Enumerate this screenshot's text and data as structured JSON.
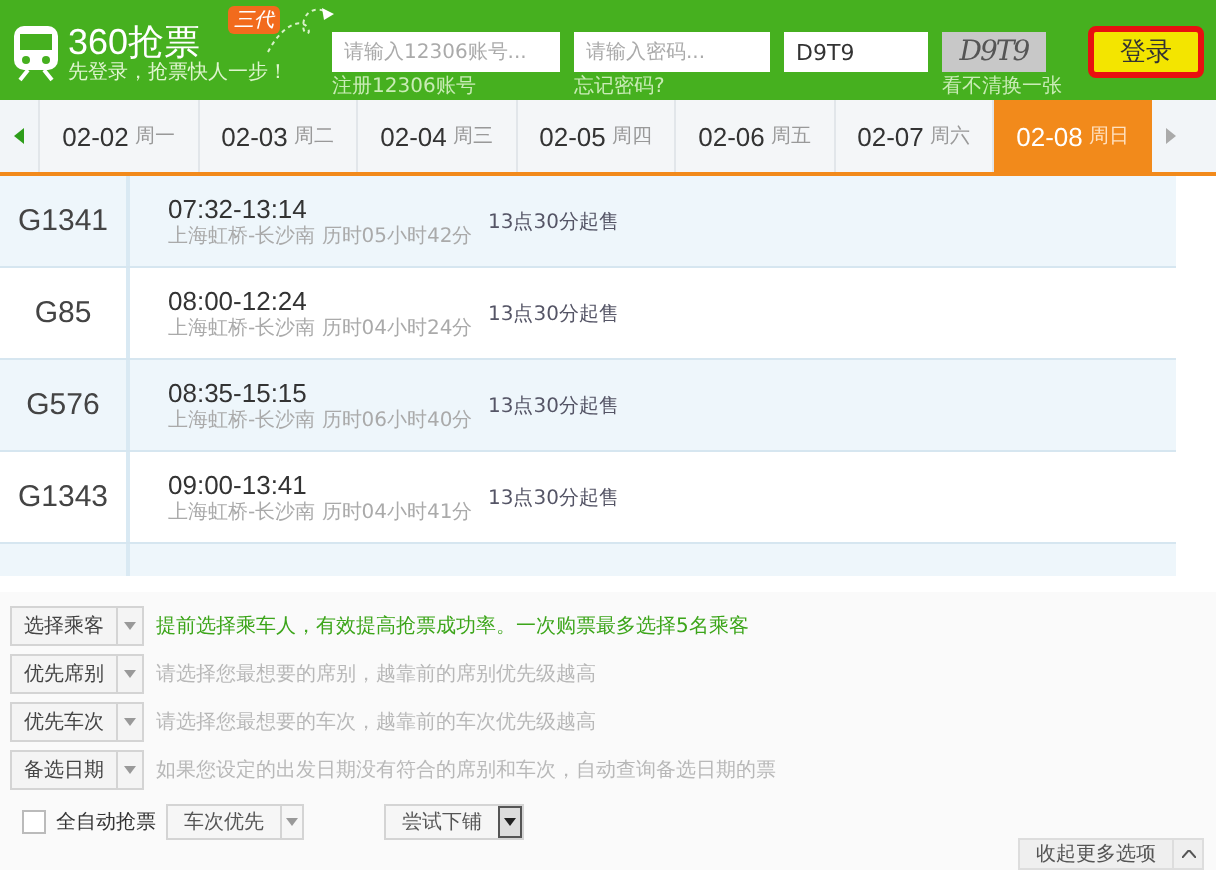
{
  "header": {
    "logo_text": "360抢票",
    "badge": "三代",
    "slogan": "先登录，抢票快人一步！",
    "account": {
      "placeholder": "请输入12306账号...",
      "link": "注册12306账号"
    },
    "password": {
      "placeholder": "请输入密码...",
      "link": "忘记密码?"
    },
    "captcha_input": {
      "value": "D9T9"
    },
    "captcha": {
      "text": "D9T9",
      "link": "看不清换一张"
    },
    "login_button": "登录"
  },
  "dates": [
    {
      "date": "02-02",
      "weekday": "周一",
      "selected": false
    },
    {
      "date": "02-03",
      "weekday": "周二",
      "selected": false
    },
    {
      "date": "02-04",
      "weekday": "周三",
      "selected": false
    },
    {
      "date": "02-05",
      "weekday": "周四",
      "selected": false
    },
    {
      "date": "02-06",
      "weekday": "周五",
      "selected": false
    },
    {
      "date": "02-07",
      "weekday": "周六",
      "selected": false
    },
    {
      "date": "02-08",
      "weekday": "周日",
      "selected": true
    }
  ],
  "trains": [
    {
      "number": "G1341",
      "time": "07:32-13:14",
      "route": "上海虹桥-长沙南 历时05小时42分",
      "sale": "13点30分起售"
    },
    {
      "number": "G85",
      "time": "08:00-12:24",
      "route": "上海虹桥-长沙南 历时04小时24分",
      "sale": "13点30分起售"
    },
    {
      "number": "G576",
      "time": "08:35-15:15",
      "route": "上海虹桥-长沙南 历时06小时40分",
      "sale": "13点30分起售"
    },
    {
      "number": "G1343",
      "time": "09:00-13:41",
      "route": "上海虹桥-长沙南 历时04小时41分",
      "sale": "13点30分起售"
    }
  ],
  "options": [
    {
      "label": "选择乘客",
      "hint": "提前选择乘车人，有效提高抢票成功率。一次购票最多选择5名乘客",
      "kind": "tip"
    },
    {
      "label": "优先席别",
      "hint": "请选择您最想要的席别，越靠前的席别优先级越高",
      "kind": "hint"
    },
    {
      "label": "优先车次",
      "hint": "请选择您最想要的车次，越靠前的车次优先级越高",
      "kind": "hint"
    },
    {
      "label": "备选日期",
      "hint": "如果您设定的出发日期没有符合的席别和车次，自动查询备选日期的票",
      "kind": "hint"
    }
  ],
  "auto": {
    "label": "全自动抢票",
    "checked": false,
    "priority": "车次优先",
    "berth": "尝试下铺"
  },
  "collapse_button": "收起更多选项"
}
